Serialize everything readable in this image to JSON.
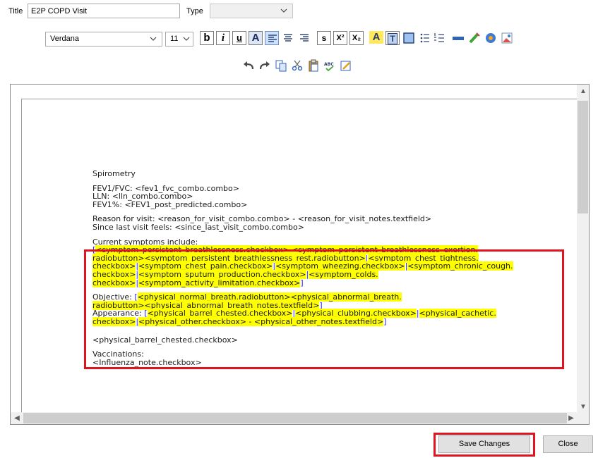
{
  "header": {
    "title_label": "Title",
    "title_value": "E2P COPD Visit",
    "type_label": "Type",
    "type_value": ""
  },
  "toolbar": {
    "font_value": "Verdana",
    "size_value": "11",
    "bold_label": "b",
    "italic_label": "i",
    "underline_label": "u",
    "fontcolor_label": "A",
    "strike_label": "s",
    "superscript_label": "X²",
    "subscript_label": "X₂",
    "highlight_label": "A",
    "textbox_label": "T"
  },
  "document": {
    "heading": "Spirometry",
    "fev_line1": "FEV1/FVC: <fev1_fvc_combo.combo>",
    "fev_line2": "LLN: <lln_combo.combo>",
    "fev_line3": "FEV1%: <FEV1_post_predicted.combo>",
    "reason_line1": "Reason for visit: <reason_for_visit_combo.combo> - <reason_for_visit_notes.textfield>",
    "reason_line2": "Since last visit feels: <since_last_visit_combo.combo>",
    "symptoms_label": "Current symptoms include:",
    "symptoms_open": "[",
    "symptoms_l1": "<symptom_persistent_breathlessness.checkbox> <symptom_persistent_breathlessness_exertion.",
    "symptoms_l2a": "radiobutton><symptom_persistent_breathlessness_rest.radiobutton>",
    "symptoms_sep1": "|",
    "symptoms_l2b": "<symptom_chest_tightness.",
    "symptoms_l3a": "checkbox>",
    "symptoms_sep2": "|",
    "symptoms_l3b": "<symptom_chest_pain.checkbox>",
    "symptoms_sep3": "|",
    "symptoms_l3c": "<symptom_wheezing.checkbox>",
    "symptoms_sep4": "|",
    "symptoms_l3d": "<symptom_chronic_cough.",
    "symptoms_l4a": "checkbox>",
    "symptoms_sep5": "|",
    "symptoms_l4b": "<symptom_sputum_production.checkbox>",
    "symptoms_sep6": "|",
    "symptoms_l4c": "<symptom_colds.",
    "symptoms_l5a": "checkbox>",
    "symptoms_sep7": "|",
    "symptoms_l5b": "<symptom_activity_limitation.checkbox>",
    "symptoms_close": "]",
    "objective_label": "Objective: ",
    "objective_open": "[",
    "objective_l1": "<physical_normal_breath.radiobutton><physical_abnormal_breath.",
    "objective_l2": "radiobutton><physical_abnormal_breath_notes.textfield>",
    "objective_close": "]",
    "appearance_label": "Appearance: ",
    "appearance_open": "[",
    "appearance_l1a": "<physical_barrel_chested.checkbox>",
    "appearance_sep1": "|",
    "appearance_l1b": "<physical_clubbing.checkbox>",
    "appearance_sep2": "|",
    "appearance_l1c": "<physical_cachetic.",
    "appearance_l2a": "checkbox>",
    "appearance_sep3": "|",
    "appearance_l2b": "<physical_other.checkbox> - <physical_other_notes.textfield>",
    "appearance_close": "]",
    "barrel_line": "<physical_barrel_chested.checkbox>",
    "vacc_label": "Vaccinations:",
    "vacc_line": "<Influenza_note.checkbox>"
  },
  "footer": {
    "save_label": "Save Changes",
    "close_label": "Close"
  },
  "colors": {
    "highlight": "#ffff00",
    "bracket": "#1c1cff",
    "annotation_red": "#e0141e"
  }
}
